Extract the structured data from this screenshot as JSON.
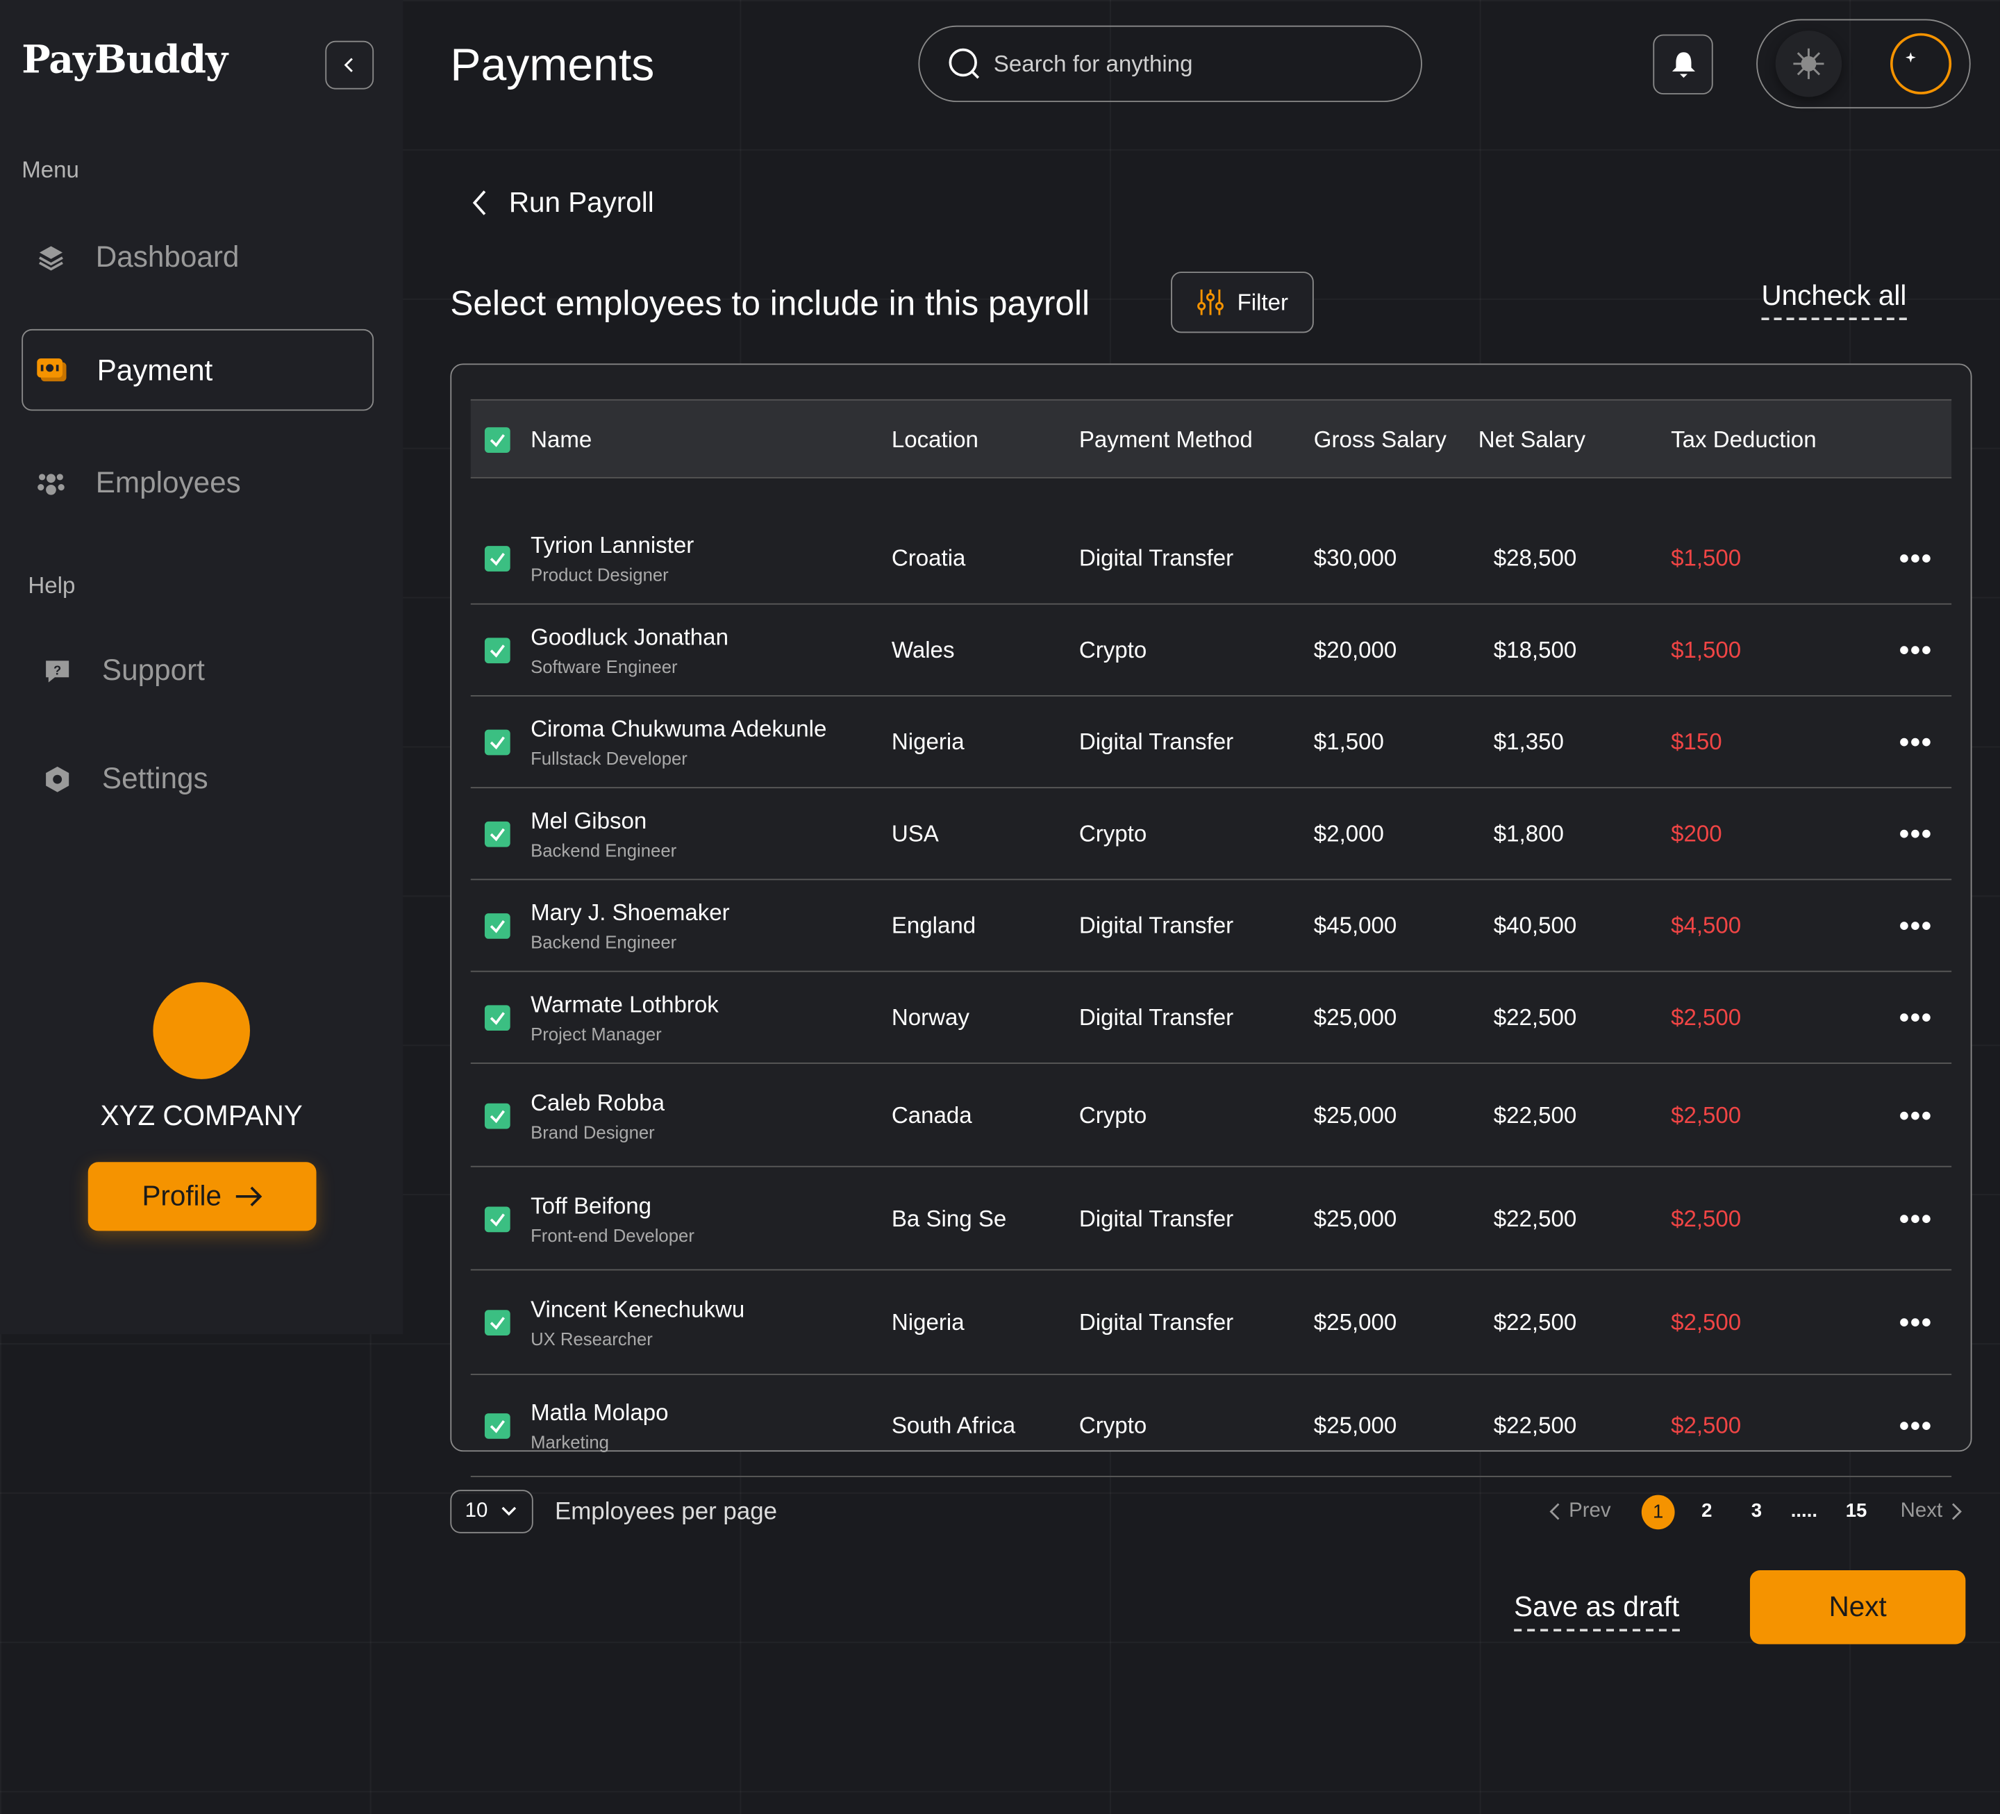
{
  "app": {
    "logo": "PayBuddy",
    "page_title": "Payments",
    "accent": "#f59300"
  },
  "search": {
    "placeholder": "Search for anything"
  },
  "sidebar": {
    "menu_label": "Menu",
    "help_label": "Help",
    "items": [
      {
        "label": "Dashboard",
        "icon": "layers-icon"
      },
      {
        "label": "Payment",
        "icon": "wallet-icon",
        "active": true
      },
      {
        "label": "Employees",
        "icon": "users-icon"
      }
    ],
    "help_items": [
      {
        "label": "Support",
        "icon": "chat-question-icon"
      },
      {
        "label": "Settings",
        "icon": "gear-icon"
      }
    ],
    "company": "XYZ COMPANY",
    "profile_button": "Profile"
  },
  "theme": {
    "mode": "dark"
  },
  "breadcrumb": {
    "back_label": "Run Payroll"
  },
  "section": {
    "subtitle": "Select employees to include in this payroll",
    "filter_label": "Filter",
    "uncheck_all": "Uncheck all"
  },
  "table": {
    "headers": [
      "Name",
      "Location",
      "Payment Method",
      "Gross Salary",
      "Net Salary",
      "Tax Deduction"
    ],
    "rows": [
      {
        "name": "Tyrion Lannister",
        "role": "Product Designer",
        "location": "Croatia",
        "method": "Digital Transfer",
        "gross": "$30,000",
        "net": "$28,500",
        "tax": "$1,500",
        "checked": true
      },
      {
        "name": "Goodluck Jonathan",
        "role": "Software Engineer",
        "location": "Wales",
        "method": "Crypto",
        "gross": "$20,000",
        "net": "$18,500",
        "tax": "$1,500",
        "checked": true
      },
      {
        "name": "Ciroma Chukwuma Adekunle",
        "role": "Fullstack Developer",
        "location": "Nigeria",
        "method": "Digital Transfer",
        "gross": "$1,500",
        "net": "$1,350",
        "tax": "$150",
        "checked": true
      },
      {
        "name": "Mel Gibson",
        "role": "Backend Engineer",
        "location": "USA",
        "method": "Crypto",
        "gross": "$2,000",
        "net": "$1,800",
        "tax": "$200",
        "checked": true
      },
      {
        "name": "Mary J. Shoemaker",
        "role": "Backend Engineer",
        "location": "England",
        "method": "Digital Transfer",
        "gross": "$45,000",
        "net": "$40,500",
        "tax": "$4,500",
        "checked": true
      },
      {
        "name": "Warmate Lothbrok",
        "role": "Project Manager",
        "location": "Norway",
        "method": "Digital Transfer",
        "gross": "$25,000",
        "net": "$22,500",
        "tax": "$2,500",
        "checked": true
      },
      {
        "name": "Caleb Robba",
        "role": "Brand Designer",
        "location": "Canada",
        "method": "Crypto",
        "gross": "$25,000",
        "net": "$22,500",
        "tax": "$2,500",
        "checked": true
      },
      {
        "name": "Toff Beifong",
        "role": "Front-end Developer",
        "location": "Ba Sing Se",
        "method": "Digital Transfer",
        "gross": "$25,000",
        "net": "$22,500",
        "tax": "$2,500",
        "checked": true
      },
      {
        "name": "Vincent Kenechukwu",
        "role": "UX Researcher",
        "location": "Nigeria",
        "method": "Digital Transfer",
        "gross": "$25,000",
        "net": "$22,500",
        "tax": "$2,500",
        "checked": true
      },
      {
        "name": "Matla Molapo",
        "role": "Marketing",
        "location": "South Africa",
        "method": "Crypto",
        "gross": "$25,000",
        "net": "$22,500",
        "tax": "$2,500",
        "checked": true
      }
    ]
  },
  "pagination": {
    "per_page": "10",
    "per_page_label": "Employees per page",
    "prev": "Prev",
    "next": "Next",
    "pages": [
      "1",
      "2",
      "3",
      ".....",
      "15"
    ],
    "current": "1"
  },
  "actions": {
    "save_draft": "Save as draft",
    "next": "Next"
  }
}
